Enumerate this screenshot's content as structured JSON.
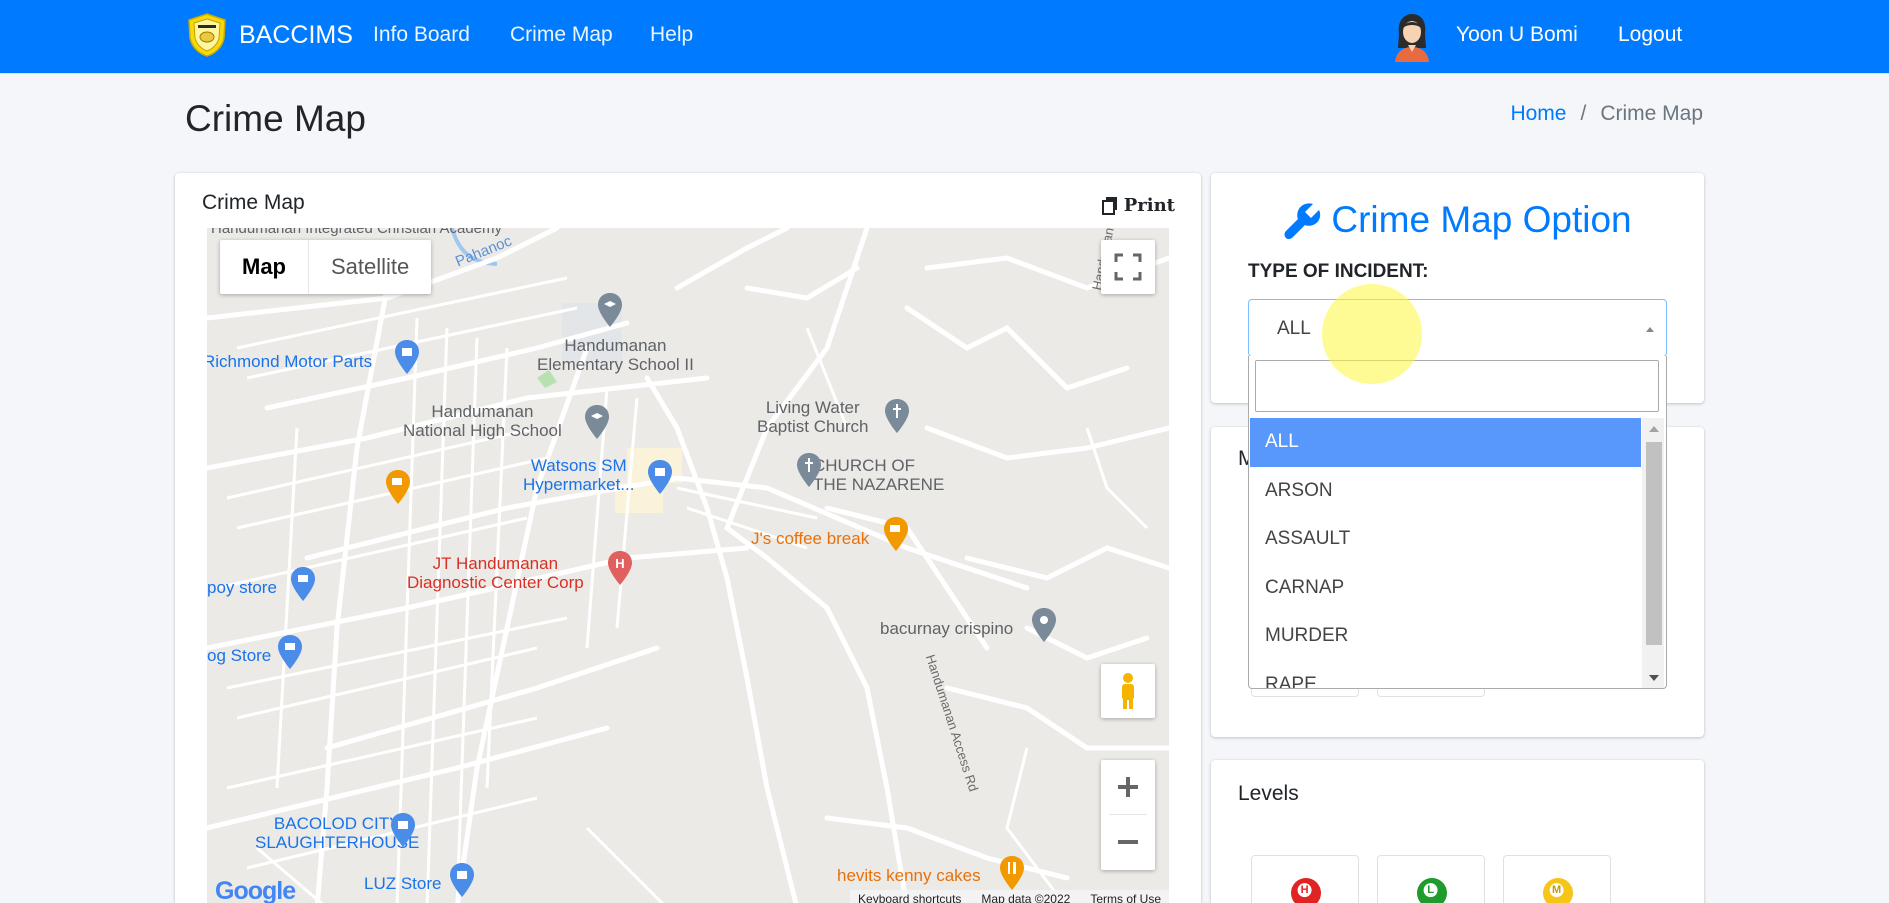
{
  "navbar": {
    "brand": "BACCIMS",
    "brand_logo_icon": "shield-logo-icon",
    "links": [
      "Info Board",
      "Crime Map",
      "Help"
    ],
    "user_name": "Yoon U Bomi",
    "logout": "Logout",
    "bg_color": "#007bff"
  },
  "header": {
    "title": "Crime Map",
    "breadcrumb": {
      "home": "Home",
      "separator": "/",
      "current": "Crime Map"
    }
  },
  "map_card": {
    "title": "Crime Map",
    "print": "Print",
    "map_type": {
      "map": "Map",
      "satellite": "Satellite",
      "selected": "Map"
    },
    "labels": {
      "integrated": "Handumanan Integrated Christian Academy",
      "pahanoc": "Pahanoc",
      "elementary": "Handumanan\nElementary School II",
      "richmond": "Richmond Motor Parts",
      "national": "Handumanan\nNational High School",
      "living_water": "Living Water\nBaptist Church",
      "watsons": "Watsons SM\nHypermarket...",
      "nazarene": "CHURCH OF\nTHE NAZARENE",
      "jt": "JT Handumanan\nDiagnostic Center Corp",
      "js_coffee": "J's coffee break",
      "poy_store": "poy store",
      "bacurnay": "bacurnay crispino",
      "og_store": "og Store",
      "slaughterhouse": "BACOLOD CITY\nSLAUGHTERHOUSE",
      "luz": "LUZ Store",
      "hevits": "hevits kenny cakes",
      "access_rd_1": "Handumanan Access Rd",
      "access_rd_2": "Handumanan Access Rd"
    },
    "google": "Google",
    "footer": [
      "Keyboard shortcuts",
      "Map data ©2022",
      "Terms of Use"
    ]
  },
  "options": {
    "title": "Crime Map Option",
    "incident_label": "TYPE OF INCIDENT:",
    "selected": "ALL",
    "search_placeholder": "",
    "items": [
      "ALL",
      "ARSON",
      "ASSAULT",
      "CARNAP",
      "MURDER",
      "RAPE"
    ],
    "accent_color": "#007bff",
    "highlight_color": "#5897fb"
  },
  "second_card": {
    "initial": "M"
  },
  "levels": {
    "title": "Levels",
    "items": [
      {
        "letter": "H",
        "color": "#e02424"
      },
      {
        "letter": "L",
        "color": "#1e9b2b"
      },
      {
        "letter": "M",
        "color": "#f5c518"
      }
    ]
  }
}
